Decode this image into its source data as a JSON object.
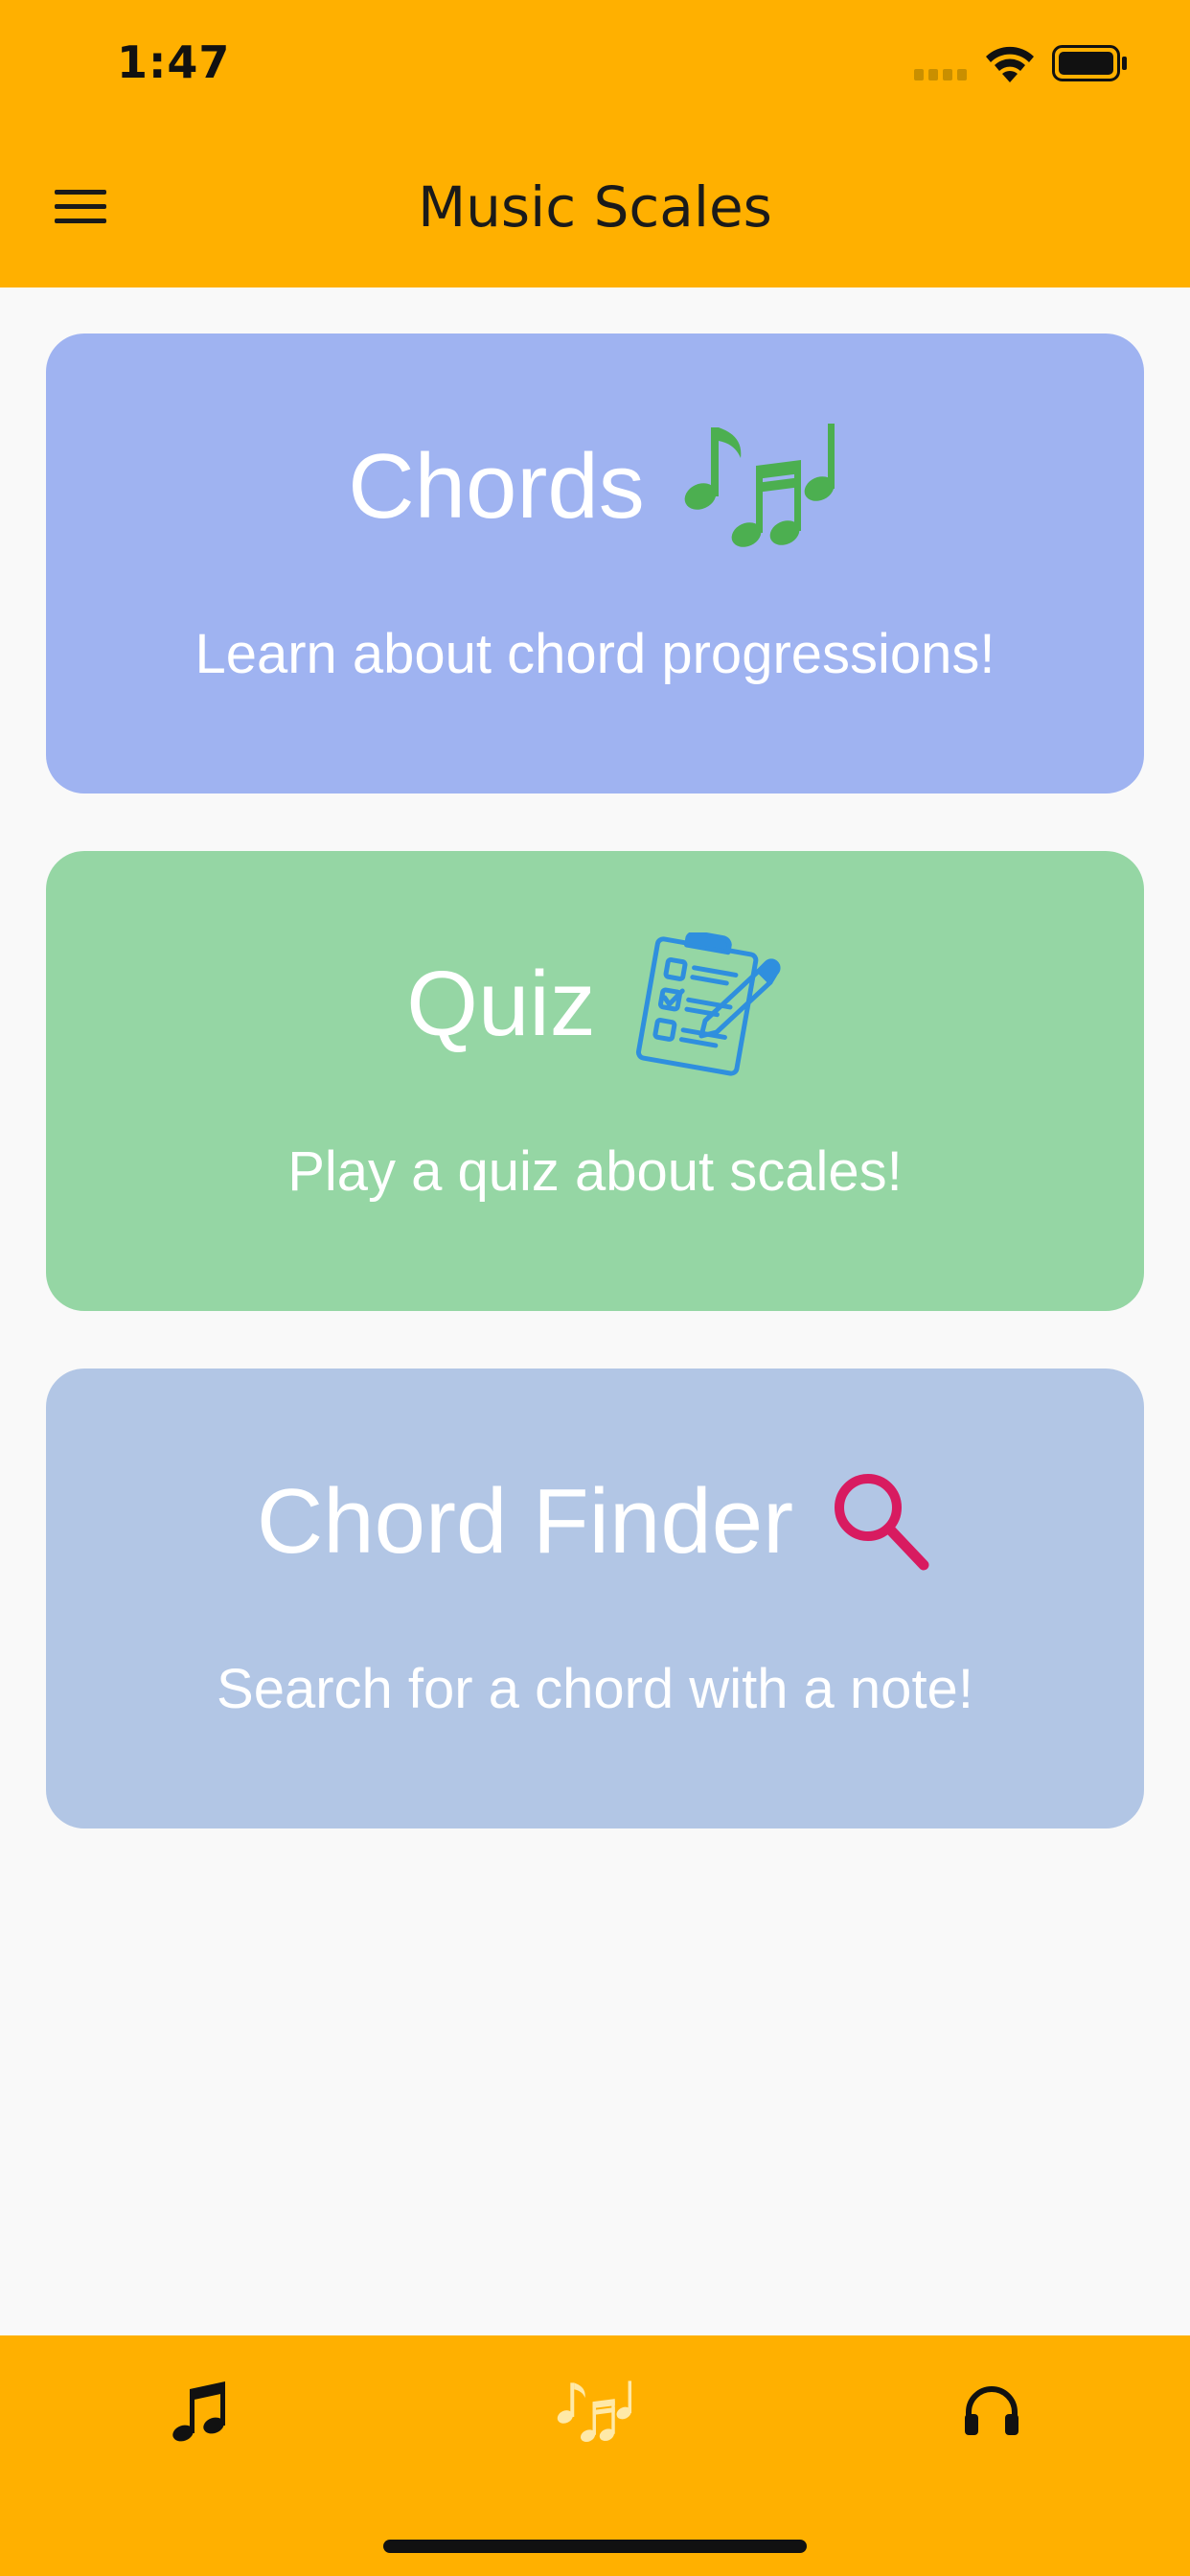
{
  "status_bar": {
    "time": "1:47"
  },
  "app_bar": {
    "title": "Music Scales",
    "menu_icon": "hamburger-menu-icon"
  },
  "cards": [
    {
      "title": "Chords",
      "subtitle": "Learn about chord progressions!",
      "icon": "music-notes-icon",
      "background": "#9fb3f1",
      "icon_color": "#4caf50"
    },
    {
      "title": "Quiz",
      "subtitle": "Play a quiz about scales!",
      "icon": "clipboard-checklist-icon",
      "background": "#95d6a4",
      "icon_color": "#2f8fde"
    },
    {
      "title": "Chord Finder",
      "subtitle": "Search for a chord with a note!",
      "icon": "magnifying-glass-icon",
      "background": "#b2c6e5",
      "icon_color": "#d81b60"
    }
  ],
  "bottom_nav": {
    "items": [
      {
        "icon": "music-note-icon",
        "color": "#111111",
        "selected": true
      },
      {
        "icon": "music-notes-icon",
        "color": "#ffe9a8",
        "selected": false
      },
      {
        "icon": "headphones-icon",
        "color": "#111111",
        "selected": false
      }
    ]
  },
  "colors": {
    "accent": "#ffb000",
    "background": "#f9f9f9"
  }
}
